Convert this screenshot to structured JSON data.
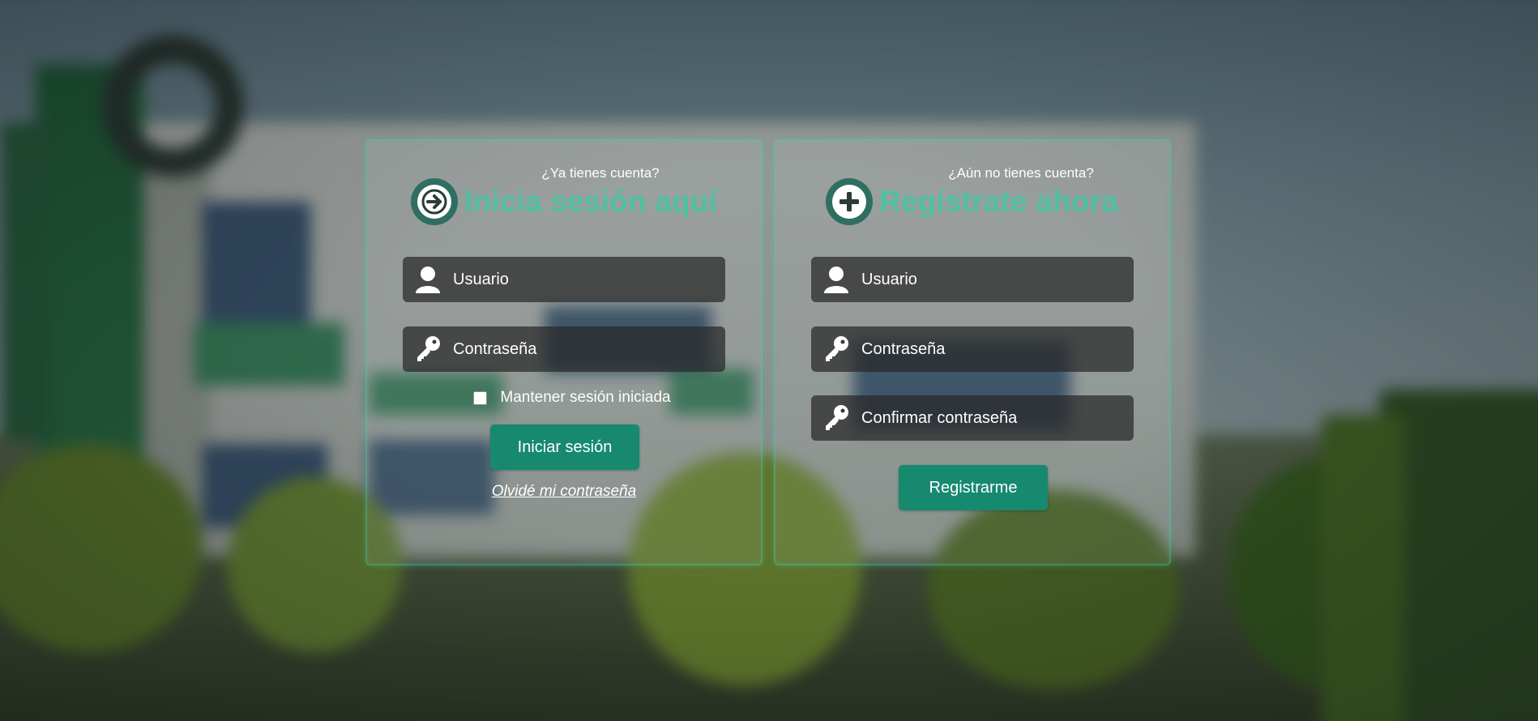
{
  "login": {
    "subtitle": "¿Ya tienes cuenta?",
    "title": "Inicia sesión aquí",
    "icon": "arrow-right-circle-icon",
    "username_placeholder": "Usuario",
    "password_placeholder": "Contraseña",
    "remember_label": "Mantener sesión iniciada",
    "remember_checked": false,
    "submit_label": "Iniciar sesión",
    "forgot_label": "Olvidé mi contraseña"
  },
  "register": {
    "subtitle": "¿Aún no tienes cuenta?",
    "title": "Regístrate ahora",
    "icon": "plus-circle-icon",
    "username_placeholder": "Usuario",
    "password_placeholder": "Contraseña",
    "confirm_placeholder": "Confirmar contraseña",
    "submit_label": "Registrarme"
  },
  "colors": {
    "accent": "#4fc1a1",
    "button": "#16896f",
    "field_background": "#282828"
  }
}
